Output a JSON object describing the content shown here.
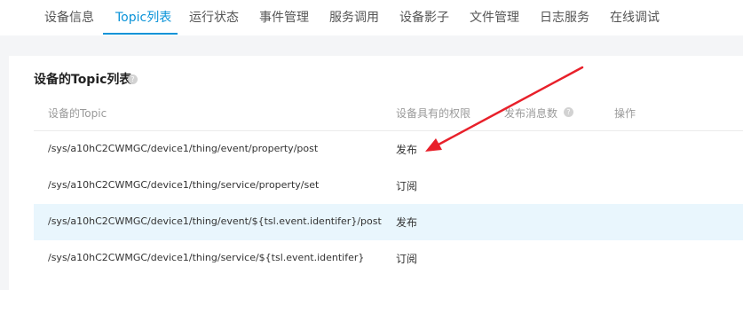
{
  "tabs": [
    {
      "label": "设备信息",
      "active": false
    },
    {
      "label": "Topic列表",
      "active": true
    },
    {
      "label": "运行状态",
      "active": false
    },
    {
      "label": "事件管理",
      "active": false
    },
    {
      "label": "服务调用",
      "active": false
    },
    {
      "label": "设备影子",
      "active": false
    },
    {
      "label": "文件管理",
      "active": false
    },
    {
      "label": "日志服务",
      "active": false
    },
    {
      "label": "在线调试",
      "active": false
    }
  ],
  "section": {
    "title": "设备的Topic列表",
    "help_icon": "question-circle-icon"
  },
  "table": {
    "columns": [
      "设备的Topic",
      "设备具有的权限",
      "发布消息数",
      "操作"
    ],
    "rows": [
      {
        "topic": "/sys/a10hC2CWMGC/device1/thing/event/property/post",
        "permission": "发布"
      },
      {
        "topic": "/sys/a10hC2CWMGC/device1/thing/service/property/set",
        "permission": "订阅"
      },
      {
        "topic": "/sys/a10hC2CWMGC/device1/thing/event/${tsl.event.identifer}/post",
        "permission": "发布"
      },
      {
        "topic": "/sys/a10hC2CWMGC/device1/thing/service/${tsl.event.identifer}",
        "permission": "订阅"
      }
    ],
    "highlighted_row": 2
  },
  "colors": {
    "accent": "#0a93d8",
    "row_highlight": "#e9f6fd",
    "annotation_arrow": "#e8202a"
  }
}
